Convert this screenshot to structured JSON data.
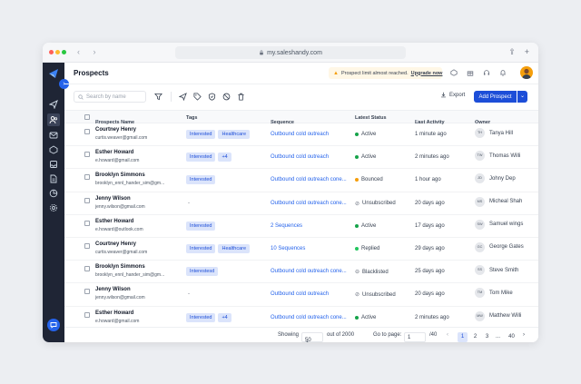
{
  "browser": {
    "url": "my.saleshandy.com"
  },
  "page": {
    "title": "Prospects"
  },
  "alert": {
    "text": "Prospect limit almost reached.",
    "link": "Upgrade now"
  },
  "search": {
    "placeholder": "Search by name"
  },
  "actions": {
    "export": "Export",
    "add": "Add Prospect"
  },
  "columns": {
    "name": "Prospects Name",
    "tags": "Tags",
    "sequence": "Sequence",
    "status": "Latest Status",
    "activity": "Last Activity",
    "owner": "Owner"
  },
  "rows": [
    {
      "name": "Courtney Henry",
      "email": "curtis.weaver@gmail.com",
      "tags": [
        "Interested",
        "Healthcare"
      ],
      "sequence": "Outbound cold outreach",
      "status": "Active",
      "activity": "1 minute ago",
      "owner_initials": "TH",
      "owner": "Tanya Hill"
    },
    {
      "name": "Esther Howard",
      "email": "e.howard@gmail.com",
      "tags": [
        "Interested",
        "+4"
      ],
      "sequence": "Outbound cold outreach",
      "status": "Active",
      "activity": "2 minutes ago",
      "owner_initials": "TW",
      "owner": "Thomas Willi"
    },
    {
      "name": "Brooklyn Simmons",
      "email": "brooklyn_ennl_hander_sim@gm...",
      "tags": [
        "Interested"
      ],
      "sequence": "Outbound cold outreach cone...",
      "status": "Bounced",
      "activity": "1 hour ago",
      "owner_initials": "JD",
      "owner": "Johny Dep"
    },
    {
      "name": "Jenny Wilson",
      "email": "jenny.wilson@gmail.com",
      "tags": [],
      "sequence": "Outbound cold outreach cone...",
      "status": "Unsubscribed",
      "activity": "20 days ago",
      "owner_initials": "MS",
      "owner": "Micheal Shah"
    },
    {
      "name": "Esther Howard",
      "email": "e.howard@outlook.com",
      "tags": [
        "Interested"
      ],
      "sequence": "2 Sequences",
      "status": "Active",
      "activity": "17 days ago",
      "owner_initials": "SW",
      "owner": "Samuel wings"
    },
    {
      "name": "Courtney Henry",
      "email": "curtis.weaver@gmail.com",
      "tags": [
        "Interested",
        "Healthcare"
      ],
      "sequence": "10 Sequences",
      "status": "Replied",
      "activity": "29 days ago",
      "owner_initials": "GC",
      "owner": "George Gates"
    },
    {
      "name": "Brooklyn Simmons",
      "email": "brooklyn_ennl_hander_sim@gm...",
      "tags": [
        "Interestesd"
      ],
      "sequence": "Outbound cold outreach cone...",
      "status": "Blacklisted",
      "activity": "25 days ago",
      "owner_initials": "SS",
      "owner": "Steve Smith"
    },
    {
      "name": "Jenny Wilson",
      "email": "jenny.wilson@gmail.com",
      "tags": [],
      "sequence": "Outbound cold outreach",
      "status": "Unsubscribed",
      "activity": "20 days ago",
      "owner_initials": "TM",
      "owner": "Tom Mike"
    },
    {
      "name": "Esther Howard",
      "email": "e.howard@gmail.com",
      "tags": [
        "Interested",
        "+4"
      ],
      "sequence": "Outbound cold outreach cone...",
      "status": "Active",
      "activity": "2 minutes ago",
      "owner_initials": "MW",
      "owner": "Matthew Willi"
    }
  ],
  "footer": {
    "showing_label": "Showing",
    "page_size": "50",
    "out_of": "out of 2000",
    "goto_label": "Go to page:",
    "goto_value": "1",
    "total_pages": "/40",
    "pages": [
      "1",
      "2",
      "3",
      "...",
      "40"
    ]
  },
  "colors": {
    "accent": "#1d4ed8",
    "sidebar": "#1f2535",
    "active": "#16a34a",
    "bounced": "#f59e0b",
    "replied": "#22c55e"
  }
}
